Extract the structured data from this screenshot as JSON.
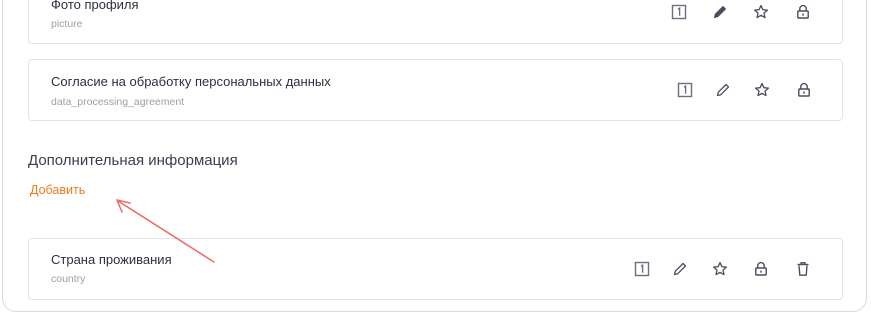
{
  "fields": [
    {
      "title": "Фото профиля",
      "key": "picture"
    },
    {
      "title": "Согласие на обработку персональных данных",
      "key": "data_processing_agreement"
    }
  ],
  "section": {
    "title": "Дополнительная информация",
    "add_label": "Добавить"
  },
  "extra_fields": [
    {
      "title": "Страна проживания",
      "key": "country"
    }
  ],
  "icons": [
    "one-badge-icon",
    "pencil-icon",
    "star-icon",
    "lock-icon",
    "trash-icon"
  ],
  "colors": {
    "accent": "#f07c1c",
    "annotation_arrow": "#e9706b",
    "icon": "#6b7080",
    "border": "#e3e5ea"
  }
}
